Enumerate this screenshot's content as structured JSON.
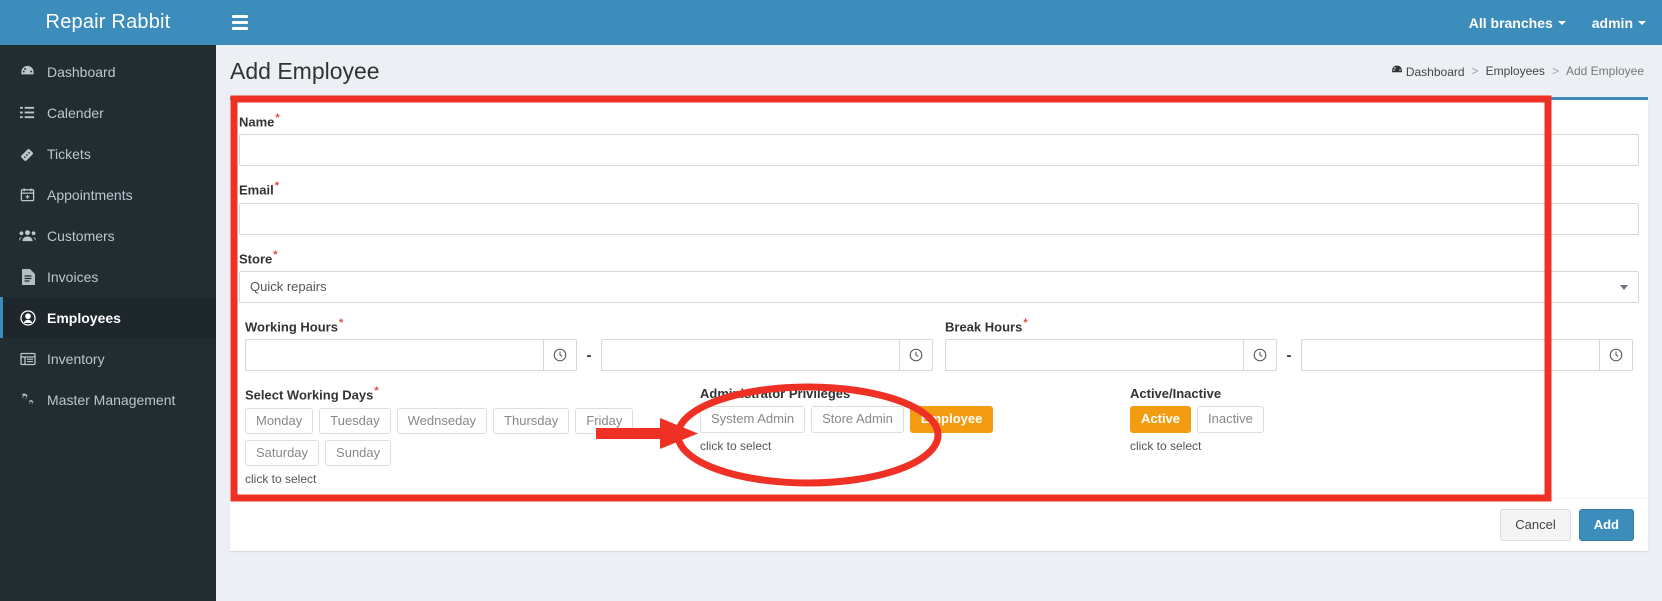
{
  "brand": {
    "title": "Repair Rabbit"
  },
  "sidebar": {
    "items": [
      {
        "label": "Dashboard",
        "icon": "dashboard-icon",
        "active": false
      },
      {
        "label": "Calender",
        "icon": "list-icon",
        "active": false
      },
      {
        "label": "Tickets",
        "icon": "ticket-icon",
        "active": false
      },
      {
        "label": "Appointments",
        "icon": "calendar-icon",
        "active": false
      },
      {
        "label": "Customers",
        "icon": "users-icon",
        "active": false
      },
      {
        "label": "Invoices",
        "icon": "document-icon",
        "active": false
      },
      {
        "label": "Employees",
        "icon": "user-circle-icon",
        "active": true
      },
      {
        "label": "Inventory",
        "icon": "table-icon",
        "active": false
      },
      {
        "label": "Master Management",
        "icon": "gears-icon",
        "active": false
      }
    ]
  },
  "topbar": {
    "menu_toggle": "hamburger-icon",
    "branches_label": "All branches",
    "user_label": "admin"
  },
  "page": {
    "title": "Add Employee",
    "breadcrumb": [
      {
        "label": "Dashboard",
        "icon": "dashboard-icon"
      },
      {
        "label": "Employees",
        "icon": ""
      },
      {
        "label": "Add Employee",
        "icon": ""
      }
    ],
    "breadcrumb_separator": ">"
  },
  "form": {
    "name": {
      "label": "Name",
      "required_mark": "*",
      "value": "",
      "placeholder": ""
    },
    "email": {
      "label": "Email",
      "required_mark": "*",
      "value": "",
      "placeholder": ""
    },
    "store": {
      "label": "Store",
      "required_mark": "*",
      "selected": "Quick repairs",
      "options": [
        "Quick repairs"
      ]
    },
    "working_hours": {
      "label": "Working Hours",
      "required_mark": "*",
      "from": "",
      "to": "",
      "separator": "-",
      "addon_icon": "clock-icon"
    },
    "break_hours": {
      "label": "Break Hours",
      "required_mark": "*",
      "from": "",
      "to": "",
      "separator": "-",
      "addon_icon": "clock-icon"
    },
    "working_days": {
      "label": "Select Working Days",
      "required_mark": "*",
      "hint": "click to select",
      "options": [
        {
          "label": "Monday",
          "selected": false
        },
        {
          "label": "Tuesday",
          "selected": false
        },
        {
          "label": "Wednseday",
          "selected": false
        },
        {
          "label": "Thursday",
          "selected": false
        },
        {
          "label": "Friday",
          "selected": false
        },
        {
          "label": "Saturday",
          "selected": false
        },
        {
          "label": "Sunday",
          "selected": false
        }
      ]
    },
    "privileges": {
      "label": "Administrator Privileges",
      "hint": "click to select",
      "options": [
        {
          "label": "System Admin",
          "selected": false
        },
        {
          "label": "Store Admin",
          "selected": false
        },
        {
          "label": "Employee",
          "selected": true
        }
      ]
    },
    "status": {
      "label": "Active/Inactive",
      "hint": "click to select",
      "options": [
        {
          "label": "Active",
          "selected": true
        },
        {
          "label": "Inactive",
          "selected": false
        }
      ]
    }
  },
  "footer": {
    "cancel_label": "Cancel",
    "add_label": "Add"
  },
  "colors": {
    "brand_blue": "#3c8dbc",
    "sidebar_dark": "#222d32",
    "accent_orange": "#f39c12",
    "annotation_red": "#ee3124",
    "page_bg": "#ecf0f5"
  }
}
